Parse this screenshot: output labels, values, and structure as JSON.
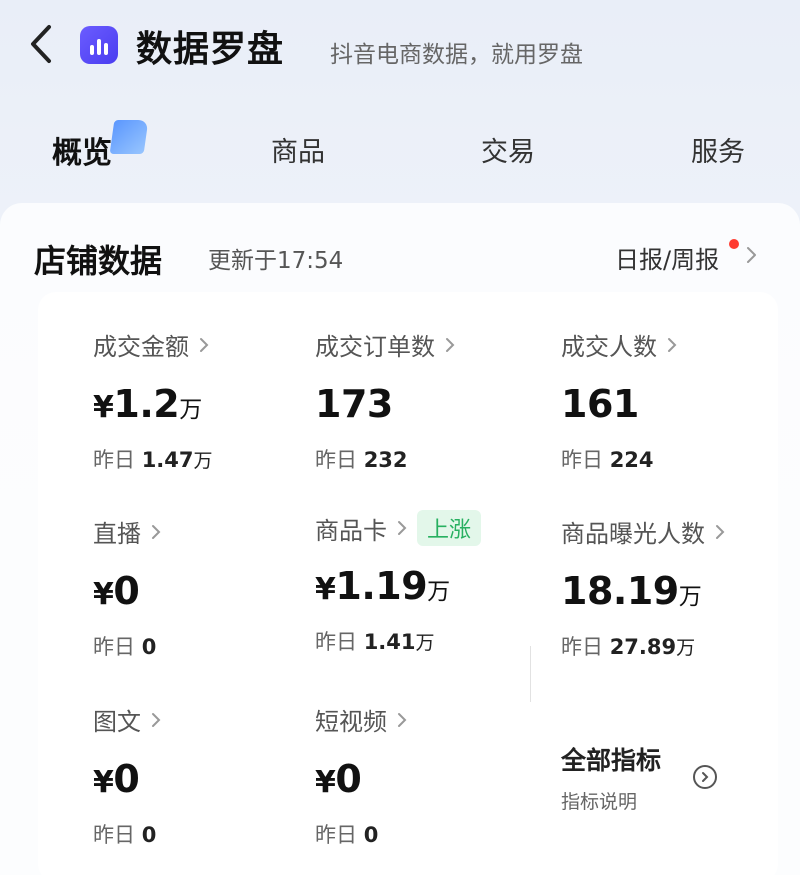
{
  "header": {
    "app_title": "数据罗盘",
    "slogan": "抖音电商数据，就用罗盘"
  },
  "tabs": [
    {
      "label": "概览",
      "active": true
    },
    {
      "label": "商品",
      "active": false
    },
    {
      "label": "交易",
      "active": false
    },
    {
      "label": "服务",
      "active": false
    }
  ],
  "store": {
    "title": "店铺数据",
    "updated": "更新于17:54",
    "report_link": "日报/周报"
  },
  "metrics": {
    "gmv": {
      "label": "成交金额",
      "prefix": "¥",
      "value": "1.2",
      "unit": "万",
      "yday_label": "昨日",
      "yday_value": "1.47",
      "yday_unit": "万"
    },
    "orders": {
      "label": "成交订单数",
      "value": "173",
      "yday_label": "昨日",
      "yday_value": "232"
    },
    "buyers": {
      "label": "成交人数",
      "value": "161",
      "yday_label": "昨日",
      "yday_value": "224"
    },
    "live": {
      "label": "直播",
      "prefix": "¥",
      "value": "0",
      "yday_label": "昨日",
      "yday_value": "0"
    },
    "product_card": {
      "label": "商品卡",
      "badge": "上涨",
      "prefix": "¥",
      "value": "1.19",
      "unit": "万",
      "yday_label": "昨日",
      "yday_value": "1.41",
      "yday_unit": "万"
    },
    "exposure": {
      "label": "商品曝光人数",
      "value": "18.19",
      "unit": "万",
      "yday_label": "昨日",
      "yday_value": "27.89",
      "yday_unit": "万"
    },
    "graphic": {
      "label": "图文",
      "prefix": "¥",
      "value": "0",
      "yday_label": "昨日",
      "yday_value": "0"
    },
    "short_video": {
      "label": "短视频",
      "prefix": "¥",
      "value": "0",
      "yday_label": "昨日",
      "yday_value": "0"
    }
  },
  "all_metrics": {
    "title": "全部指标",
    "subtitle": "指标说明"
  },
  "colors": {
    "accent": "#4b8dff",
    "badge_bg": "#e3f7ea",
    "badge_text": "#27b060",
    "dot": "#ff3b30"
  }
}
